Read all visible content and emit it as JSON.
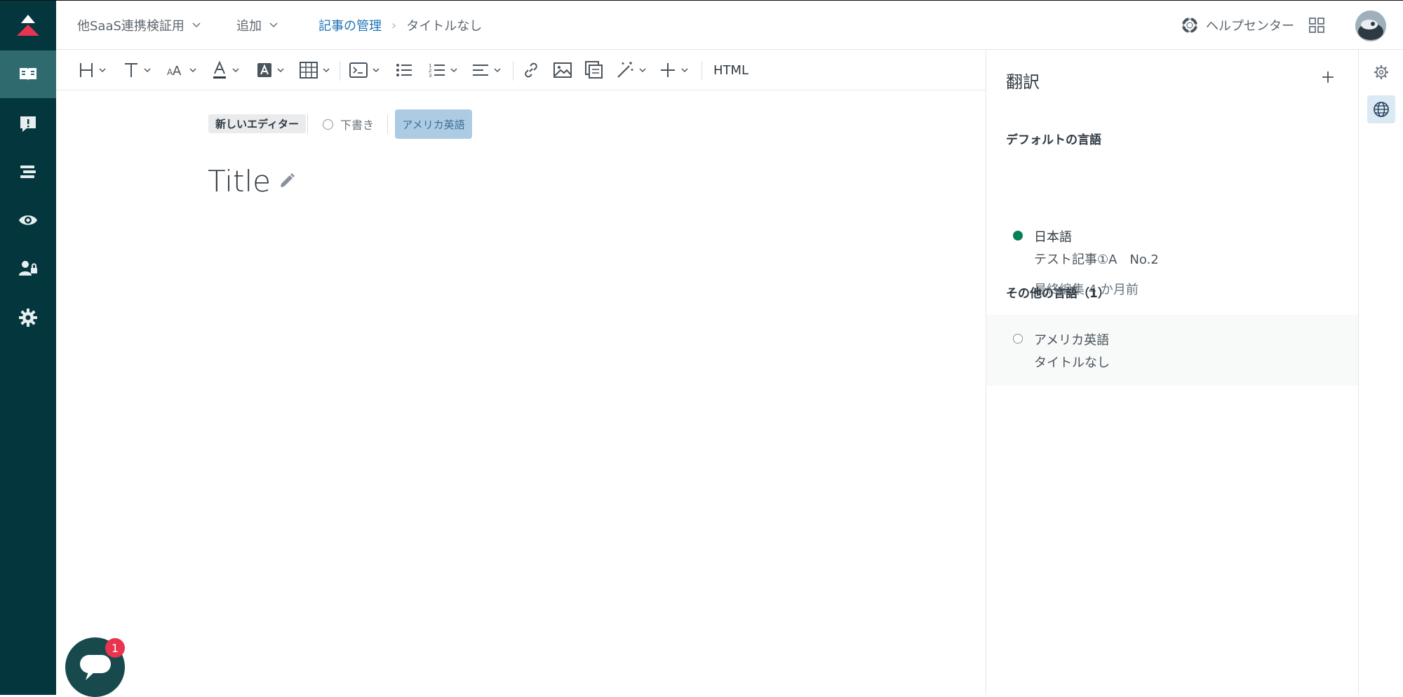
{
  "header": {
    "workspace": "他SaaS連携検証用",
    "add": "追加",
    "breadcrumb_link": "記事の管理",
    "breadcrumb_current": "タイトルなし",
    "help_center": "ヘルプセンター"
  },
  "toolbar": {
    "html_label": "HTML"
  },
  "editor": {
    "new_editor_badge": "新しいエディター",
    "draft_label": "下書き",
    "language_button": "アメリカ英語",
    "title_placeholder": "Title"
  },
  "translation_panel": {
    "title": "翻訳",
    "default_section": "デフォルトの言語",
    "default_language": {
      "name": "日本語",
      "article_title": "テスト記事①A　No.2",
      "last_edited": "最終編集 4 か月前"
    },
    "other_section": "その他の言語（1）",
    "other_languages": [
      {
        "name": "アメリカ英語",
        "article_title": "タイトルなし"
      }
    ]
  },
  "chat": {
    "badge_count": "1"
  },
  "colors": {
    "nav_bg": "#03363d",
    "nav_active": "#2f6a6f",
    "link": "#1f73b7",
    "published_dot": "#038153",
    "lang_button_bg": "#adcce4",
    "badge": "#e8344e",
    "logo_red": "#e8344e"
  }
}
